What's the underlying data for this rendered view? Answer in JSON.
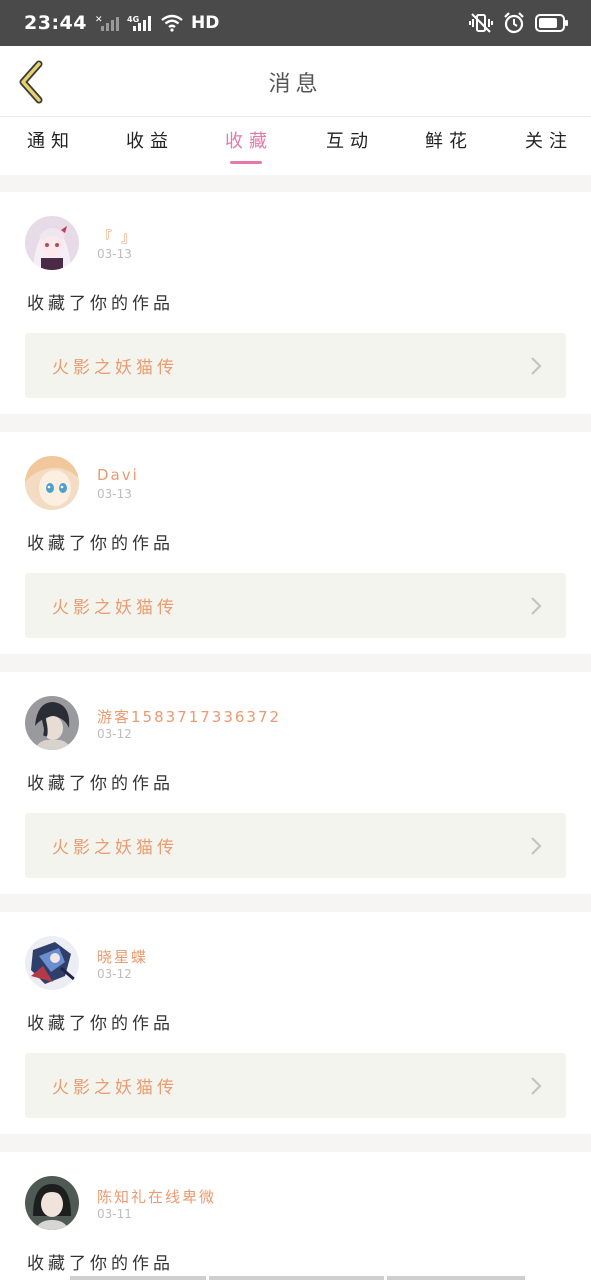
{
  "status_bar": {
    "time": "23:44",
    "network": "HD",
    "icons": [
      "signal-x-icon",
      "signal-4g-icon",
      "wifi-icon",
      "vibrate-icon",
      "alarm-icon",
      "battery-icon"
    ]
  },
  "header": {
    "title": "消息",
    "back_icon": "chevron-left-icon",
    "accent_color": "#e8d36a"
  },
  "tabs": [
    {
      "label": "通知"
    },
    {
      "label": "收益"
    },
    {
      "label": "收藏",
      "active": true
    },
    {
      "label": "互动"
    },
    {
      "label": "鲜花"
    },
    {
      "label": "关注"
    }
  ],
  "accent": "#e37aa9",
  "messages": [
    {
      "username": "『 』",
      "date": "03-13",
      "action": "收藏了你的作品",
      "work": "火影之妖猫传"
    },
    {
      "username": "Davi",
      "date": "03-13",
      "action": "收藏了你的作品",
      "work": "火影之妖猫传"
    },
    {
      "username": "游客1583717336372",
      "date": "03-12",
      "action": "收藏了你的作品",
      "work": "火影之妖猫传"
    },
    {
      "username": "晓星蝶",
      "date": "03-12",
      "action": "收藏了你的作品",
      "work": "火影之妖猫传"
    },
    {
      "username": "陈知礼在线卑微",
      "date": "03-11",
      "action": "收藏了你的作品",
      "work": ""
    }
  ]
}
